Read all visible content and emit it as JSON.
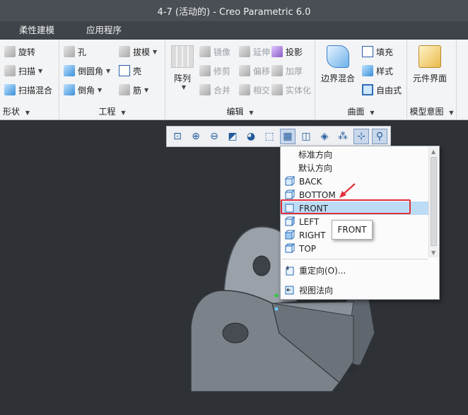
{
  "window": {
    "title": "4-7 (活动的) - Creo Parametric 6.0"
  },
  "menubar": {
    "items": [
      "柔性建模",
      "应用程序"
    ]
  },
  "ribbon": {
    "shape": {
      "label": "形状",
      "buttons": [
        "旋转",
        "扫描",
        "扫描混合"
      ]
    },
    "engineering": {
      "label": "工程",
      "buttons": [
        "孔",
        "拔模",
        "倒圆角",
        "壳",
        "倒角",
        "筋"
      ]
    },
    "edit": {
      "label": "编辑",
      "array": "阵列",
      "buttons": [
        "镜像",
        "延伸",
        "投影",
        "修剪",
        "偏移",
        "加厚",
        "合并",
        "相交",
        "实体化"
      ]
    },
    "surface": {
      "label": "曲面",
      "boundary_blend": "边界混合",
      "buttons": [
        "填充",
        "样式",
        "自由式"
      ]
    },
    "model_intent": {
      "label": "模型意图",
      "component_interface": "元件界面"
    }
  },
  "view_toolbar": {
    "icons": [
      "refit-icon",
      "zoom-in-icon",
      "zoom-out-icon",
      "repaint-icon",
      "display-style-icon",
      "saved-orientations-icon",
      "named-views-icon",
      "view-manager-icon",
      "appearance-icon",
      "datum-display-icon",
      "spin-center-icon",
      "annotation-display-icon"
    ]
  },
  "orientation_menu": {
    "items": [
      {
        "label": "标准方向",
        "icon": ""
      },
      {
        "label": "默认方向",
        "icon": ""
      },
      {
        "label": "BACK",
        "icon": "view-cube-icon"
      },
      {
        "label": "BOTTOM",
        "icon": "view-cube-icon"
      },
      {
        "label": "FRONT",
        "icon": "view-square-icon"
      },
      {
        "label": "LEFT",
        "icon": "view-cube-icon"
      },
      {
        "label": "RIGHT",
        "icon": "view-cube-icon"
      },
      {
        "label": "TOP",
        "icon": "view-cube-icon"
      }
    ],
    "selected": "FRONT",
    "actions": [
      {
        "label": "重定向(O)...",
        "icon": "reorient-icon"
      },
      {
        "label": "视图法向",
        "icon": "view-normal-icon"
      }
    ]
  },
  "tooltip": {
    "text": "FRONT"
  },
  "colors": {
    "highlight": "#bcdcf6",
    "annotation": "#e0303a",
    "model": "#8f959c"
  }
}
